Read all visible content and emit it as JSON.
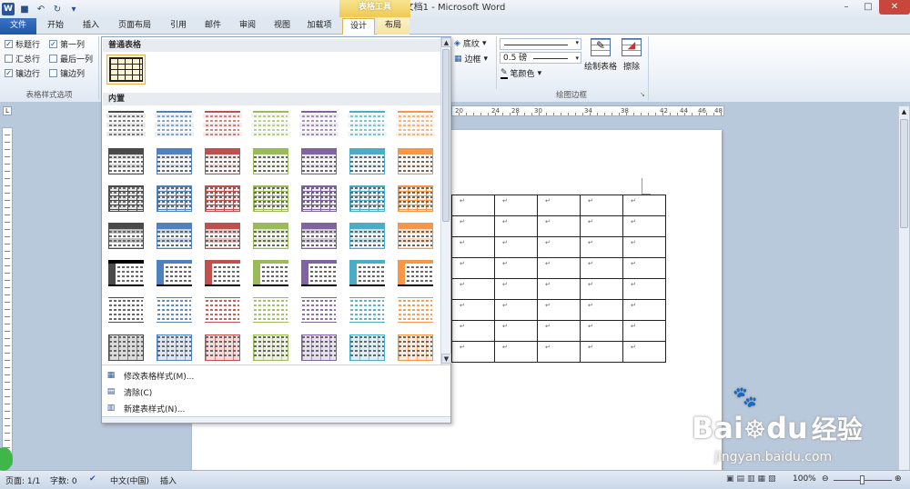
{
  "window": {
    "title": "文档1 - Microsoft Word",
    "context_group": "表格工具"
  },
  "tabs": [
    "文件",
    "开始",
    "插入",
    "页面布局",
    "引用",
    "邮件",
    "审阅",
    "视图",
    "加载项",
    "设计",
    "布局"
  ],
  "style_options": {
    "items": [
      {
        "label": "标题行",
        "checked": true
      },
      {
        "label": "第一列",
        "checked": true
      },
      {
        "label": "汇总行",
        "checked": false
      },
      {
        "label": "最后一列",
        "checked": false
      },
      {
        "label": "镶边行",
        "checked": true
      },
      {
        "label": "镶边列",
        "checked": false
      }
    ],
    "group_label": "表格样式选项"
  },
  "borders_group": {
    "shading": "底纹",
    "borders": "边框",
    "pen_weight": "0.5 磅",
    "pen_color": "笔颜色",
    "draw_table": "绘制表格",
    "eraser": "擦除",
    "group_label": "绘图边框"
  },
  "gallery": {
    "header_plain": "普通表格",
    "header_builtin": "内置",
    "column_colors": [
      "#4a4a4a",
      "#4f81bd",
      "#c0504d",
      "#9bbb59",
      "#8064a2",
      "#4bacc6",
      "#f79646"
    ],
    "menu": [
      {
        "label": "修改表格样式(M)..."
      },
      {
        "label": "清除(C)"
      },
      {
        "label": "新建表样式(N)..."
      }
    ]
  },
  "ruler": {
    "ticks": [
      "20",
      "24",
      "28",
      "30",
      "34",
      "38",
      "42",
      "44",
      "46",
      "48"
    ]
  },
  "document": {
    "cell_mark": "↵",
    "rows": 8,
    "cols": 5
  },
  "status": {
    "page": "页面: 1/1",
    "words": "字数: 0",
    "language": "中文(中国)",
    "mode": "插入",
    "zoom": "100%"
  },
  "watermark": {
    "brand": "Bai",
    "brand2": "du",
    "cn": "经验",
    "url": "jingyan.baidu.com"
  }
}
